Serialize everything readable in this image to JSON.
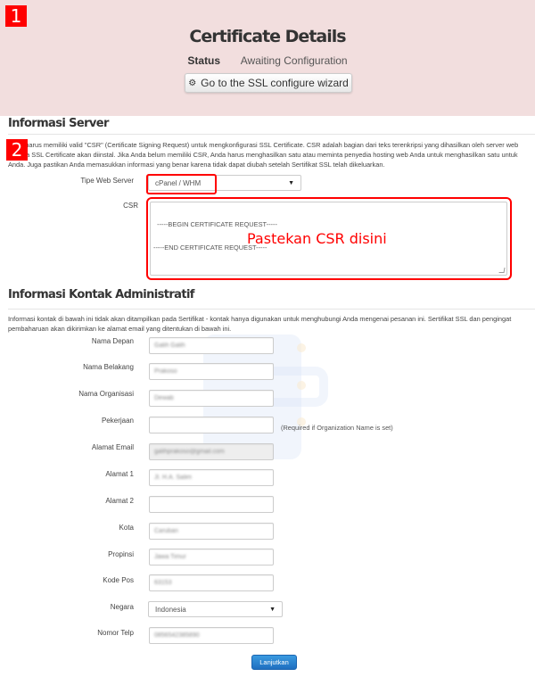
{
  "header": {
    "badge": "1",
    "title": "Certificate Details",
    "status_label": "Status",
    "status_value": "Awaiting Configuration",
    "wizard_button": "Go to the SSL configure wizard",
    "wizard_icon": "gear-icon",
    "background_color": "#f2dede"
  },
  "server_section": {
    "badge": "2",
    "title": "Informasi Server",
    "description": "Anda harus memiliki valid \"CSR\" (Certificate Signing Request) untuk mengkonfigurasi SSL Certificate. CSR adalah bagian dari teks terenkripsi yang dihasilkan oleh server web dimana SSL Certificate akan diinstal. Jika Anda belum memiliki CSR, Anda harus menghasilkan satu atau meminta penyedia hosting web Anda untuk menghasilkan satu untuk Anda. Juga pastikan Anda memasukkan informasi yang benar karena tidak dapat diubah setelah Sertifikat SSL telah dikeluarkan.",
    "web_server_label": "Tipe Web Server",
    "web_server_value": "cPanel / WHM",
    "csr_label": "CSR",
    "csr_value": "-----BEGIN CERTIFICATE REQUEST-----\n\n-----END CERTIFICATE REQUEST-----",
    "annotation": "Pastekan CSR disini",
    "highlight_color": "#ff0000"
  },
  "contact_section": {
    "title": "Informasi Kontak Administratif",
    "description": "Informasi kontak di bawah ini tidak akan ditampilkan pada Sertifikat - kontak hanya digunakan untuk menghubungi Anda mengenai pesanan ini. Sertifikat SSL dan pengingat pembaharuan akan dikirimkan ke alamat email yang ditentukan di bawah ini.",
    "fields": [
      {
        "label": "Nama Depan",
        "value": "Galih Galih"
      },
      {
        "label": "Nama Belakang",
        "value": "Prakoso"
      },
      {
        "label": "Nama Organisasi",
        "value": "Dewab"
      },
      {
        "label": "Pekerjaan",
        "value": ""
      },
      {
        "label": "Alamat Email",
        "value": "galihprakoso@gmail.com"
      },
      {
        "label": "Alamat 1",
        "value": "Jl. H.A. Salim"
      },
      {
        "label": "Alamat 2",
        "value": ""
      },
      {
        "label": "Kota",
        "value": "Caruban"
      },
      {
        "label": "Propinsi",
        "value": "Jawa Timur"
      },
      {
        "label": "Kode Pos",
        "value": "63153"
      },
      {
        "label": "Negara",
        "value": "Indonesia"
      },
      {
        "label": "Nomor Telp",
        "value": "0856542385890"
      }
    ],
    "required_note": "(Required if Organization Name is set)",
    "submit_button": "Lanjutkan",
    "submit_color": "#2a84d2"
  }
}
